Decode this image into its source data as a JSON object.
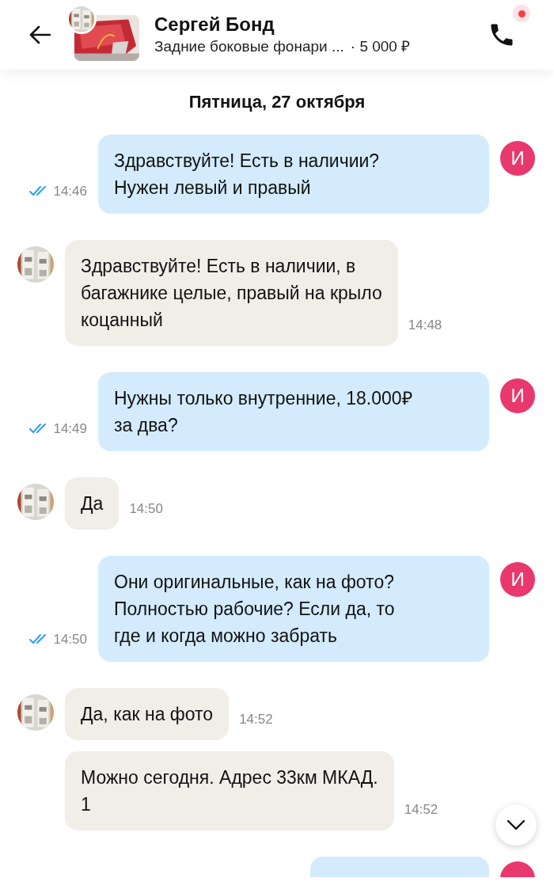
{
  "header": {
    "name": "Сергей Бонд",
    "listing": "Задние боковые фонари ...",
    "price": "· 5 000 ₽",
    "notification": true
  },
  "date": "Пятница, 27 октября",
  "messages": [
    {
      "kind": "outgoing",
      "text": "Здравствуйте! Есть в наличии?\nНужен левый и правый",
      "time": "14:46",
      "read": true,
      "avatar": "И"
    },
    {
      "kind": "incoming",
      "text": "Здравствуйте! Есть в наличии, в\nбагажнике целые, правый на крыло\nкоцанный",
      "time": "14:48",
      "show_avatar": true
    },
    {
      "kind": "outgoing",
      "text": "Нужны только внутренние, 18.000₽\nза два?",
      "time": "14:49",
      "read": true,
      "avatar": "И"
    },
    {
      "kind": "incoming",
      "text": "Да",
      "time": "14:50",
      "show_avatar": true
    },
    {
      "kind": "outgoing",
      "text": "Они оригинальные, как на фото?\nПолностью рабочие? Если да, то\nгде и когда можно забрать",
      "time": "14:50",
      "read": true,
      "avatar": "И"
    },
    {
      "kind": "incoming",
      "text": "Да, как на фото",
      "time": "14:52",
      "show_avatar": true
    },
    {
      "kind": "incoming",
      "text": "Можно сегодня. Адрес 33км МКАД.\n1",
      "time": "14:52",
      "show_avatar": false
    },
    {
      "kind": "outgoing_cut"
    }
  ]
}
